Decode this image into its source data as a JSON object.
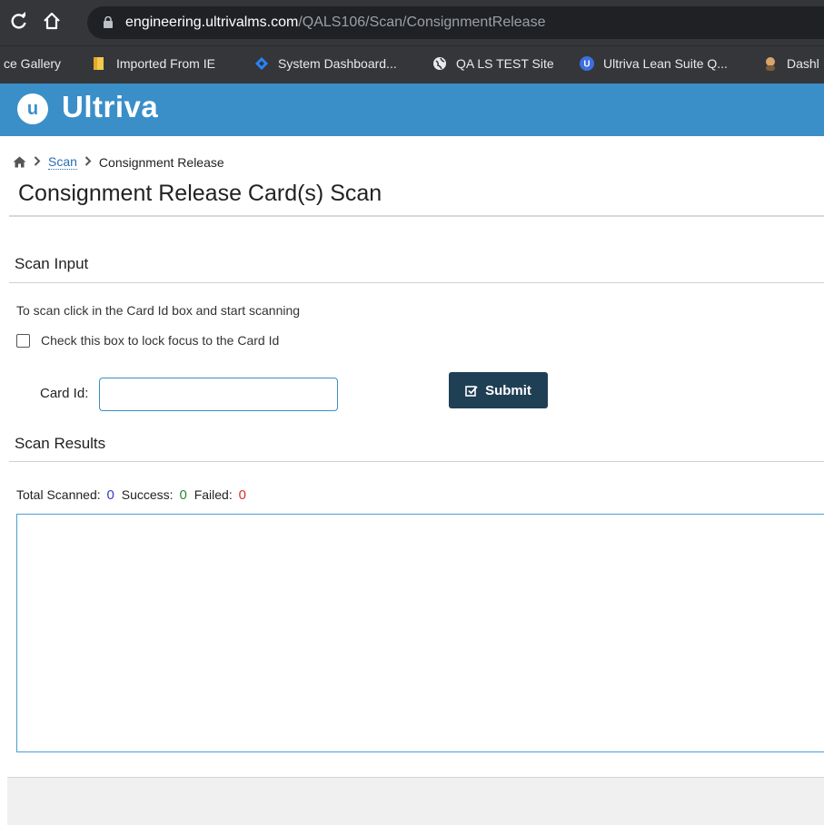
{
  "browser": {
    "url_host": "engineering.ultrivalms.com",
    "url_path": "/QALS106/Scan/ConsignmentRelease",
    "bookmarks": [
      {
        "label": "ce Gallery",
        "icon": "none"
      },
      {
        "label": "Imported From IE",
        "icon": "folder-icon"
      },
      {
        "label": "System Dashboard...",
        "icon": "diamond-icon"
      },
      {
        "label": "QA LS TEST Site",
        "icon": "globe-icon"
      },
      {
        "label": "Ultriva Lean Suite Q...",
        "icon": "ultriva-icon"
      },
      {
        "label": "Dashl",
        "icon": "avatar-icon"
      }
    ]
  },
  "app": {
    "logo_letter": "u",
    "brand": "Ultriva",
    "brand_color": "#3a8fc8"
  },
  "breadcrumb": {
    "items": [
      "Scan",
      "Consignment Release"
    ]
  },
  "page": {
    "title": "Consignment Release Card(s) Scan"
  },
  "scan_input": {
    "heading": "Scan Input",
    "instruction": "To scan click in the Card Id box and start scanning",
    "lock_focus_label": "Check this box to lock focus to the Card Id",
    "lock_focus_checked": false,
    "card_id_label": "Card Id:",
    "card_id_value": "",
    "submit_label": "Submit"
  },
  "scan_results": {
    "heading": "Scan Results",
    "total_label": "Total Scanned:",
    "total_value": "0",
    "success_label": "Success:",
    "success_value": "0",
    "failed_label": "Failed:",
    "failed_value": "0"
  }
}
